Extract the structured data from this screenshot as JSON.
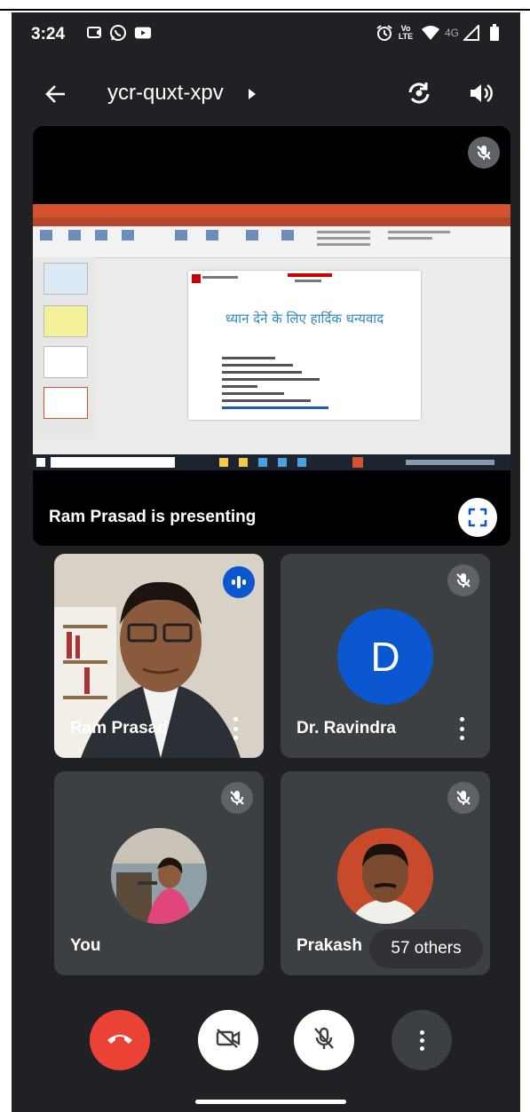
{
  "status_bar": {
    "time": "3:24",
    "network": "4G",
    "volte": "Vo LTE"
  },
  "app_bar": {
    "meeting_code": "ycr-quxt-xpv"
  },
  "presentation": {
    "presenter_label": "Ram Prasad is presenting",
    "slide_title": "ध्यान देने के लिए हार्दिक धन्यवाद"
  },
  "participants": [
    {
      "name": "Ram Prasad",
      "speaking": true
    },
    {
      "name": "Dr. Ravindra",
      "initial": "D",
      "muted": true
    },
    {
      "name": "You",
      "muted": true
    },
    {
      "name": "Prakash",
      "muted": true,
      "others_label": "57 others"
    }
  ],
  "colors": {
    "background": "#202124",
    "tile": "#3c4043",
    "end_call": "#ea4335",
    "accent": "#0b57d0"
  },
  "icons": [
    "back-arrow-icon",
    "switch-camera-icon",
    "speaker-icon",
    "mic-off-icon",
    "fullscreen-icon",
    "speaking-icon",
    "more-vert-icon",
    "end-call-icon",
    "video-off-icon"
  ]
}
